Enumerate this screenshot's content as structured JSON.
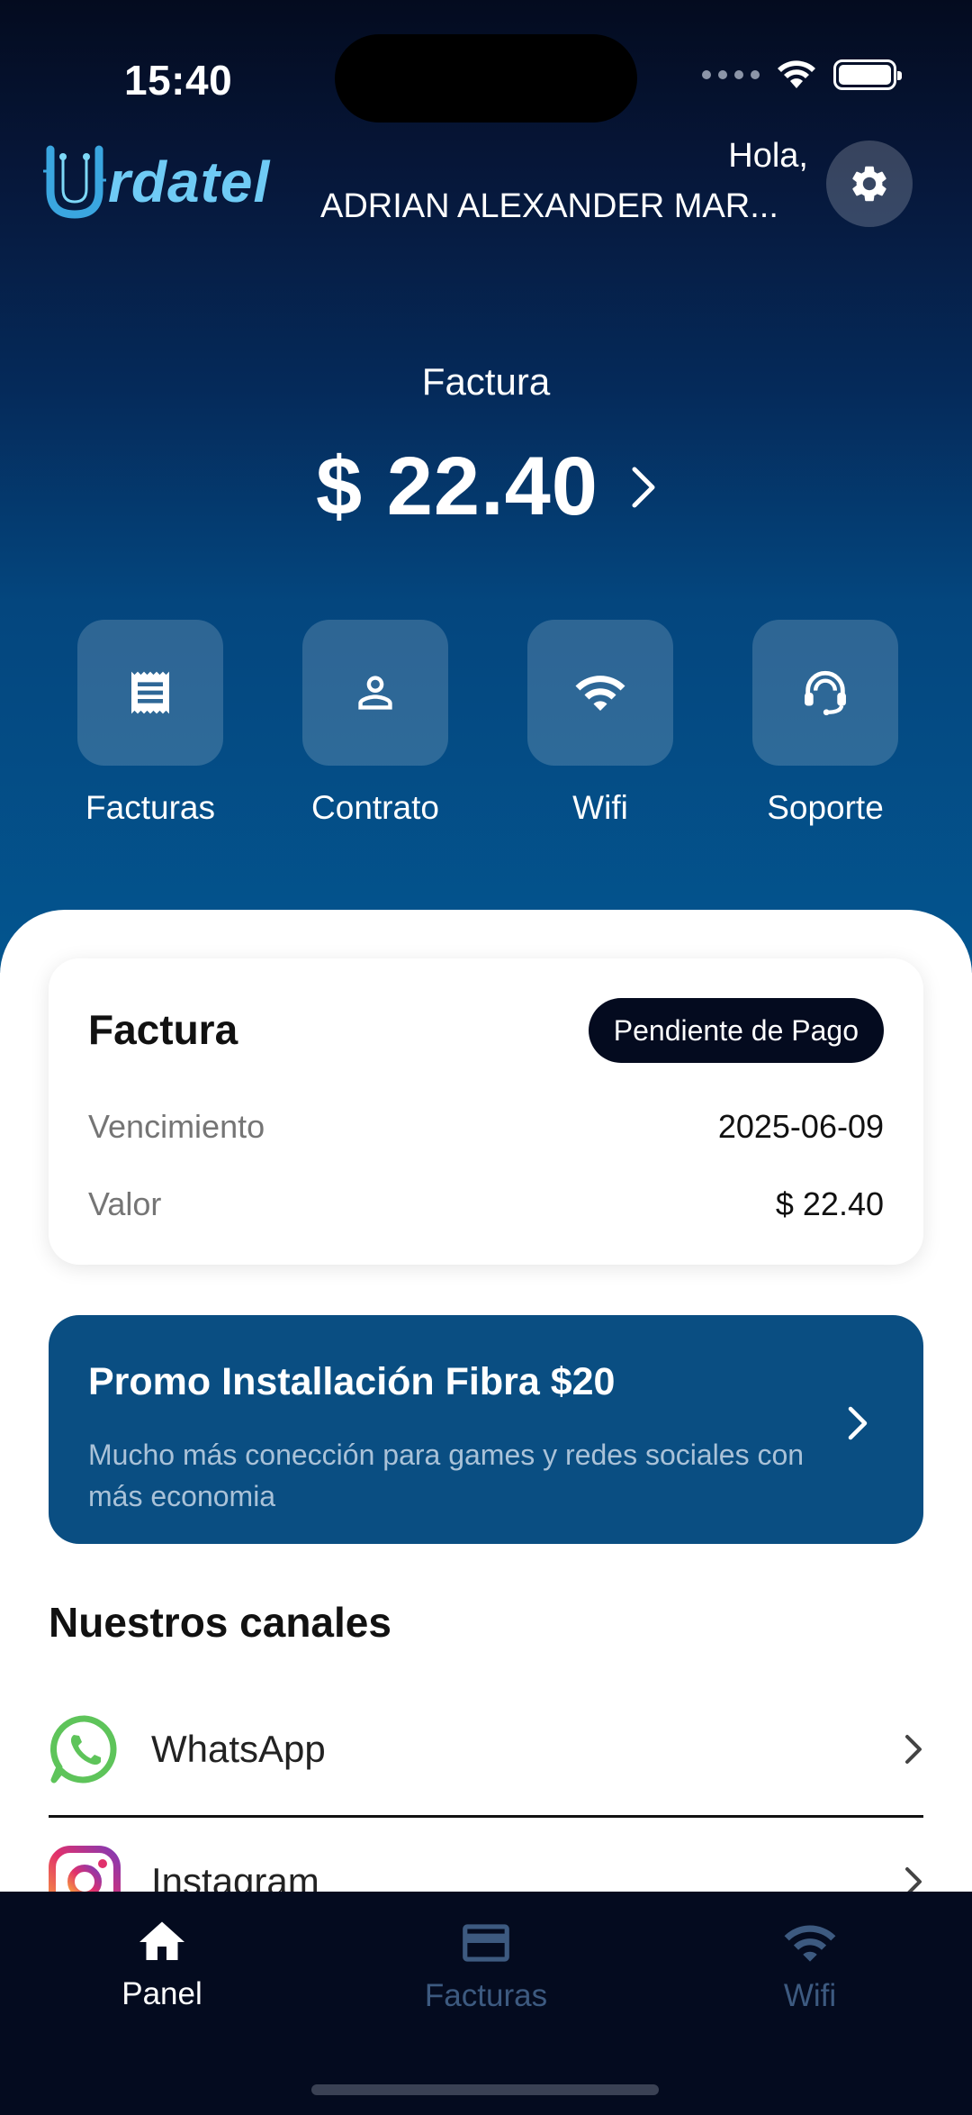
{
  "status_bar": {
    "time": "15:40"
  },
  "header": {
    "logo_letter": "U",
    "logo_text": "rdatel",
    "greeting": "Hola,",
    "user_name": "ADRIAN ALEXANDER MAR..."
  },
  "hero": {
    "label": "Factura",
    "amount": "$ 22.40"
  },
  "actions": [
    {
      "label": "Facturas",
      "icon": "receipt-icon"
    },
    {
      "label": "Contrato",
      "icon": "person-icon"
    },
    {
      "label": "Wifi",
      "icon": "wifi-icon"
    },
    {
      "label": "Soporte",
      "icon": "support-agent-icon"
    }
  ],
  "invoice_card": {
    "title": "Factura",
    "status": "Pendiente de Pago",
    "rows": [
      {
        "label": "Vencimiento",
        "value": "2025-06-09"
      },
      {
        "label": "Valor",
        "value": "$ 22.40"
      }
    ]
  },
  "promo": {
    "title": "Promo Installación Fibra $20",
    "description": "Mucho más conección para games y redes sociales con más economia"
  },
  "channels": {
    "title": "Nuestros canales",
    "items": [
      {
        "label": "WhatsApp",
        "icon": "whatsapp-icon"
      },
      {
        "label": "Instagram",
        "icon": "instagram-icon"
      }
    ]
  },
  "bottom_nav": {
    "items": [
      {
        "label": "Panel",
        "icon": "home-icon",
        "active": true
      },
      {
        "label": "Facturas",
        "icon": "credit-card-icon",
        "active": false
      },
      {
        "label": "Wifi",
        "icon": "wifi-icon",
        "active": false
      }
    ]
  },
  "colors": {
    "accent_dark": "#040b1f",
    "promo_blue": "#0a4e82",
    "logo_cyan": "#6fcbf5",
    "nav_inactive": "#3d5a80"
  }
}
